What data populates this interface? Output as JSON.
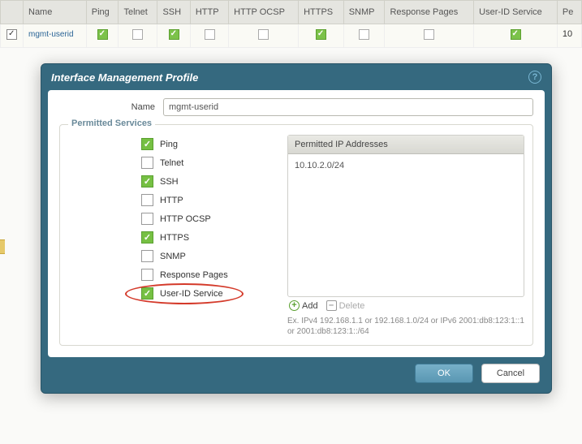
{
  "table": {
    "headers": [
      "",
      "Name",
      "Ping",
      "Telnet",
      "SSH",
      "HTTP",
      "HTTP OCSP",
      "HTTPS",
      "SNMP",
      "Response Pages",
      "User-ID Service",
      "Pe"
    ],
    "row": {
      "selected": true,
      "name": "mgmt-userid",
      "ping": true,
      "telnet": false,
      "ssh": true,
      "http": false,
      "http_ocsp": false,
      "https": true,
      "snmp": false,
      "response_pages": false,
      "userid_service": true,
      "trail": "10"
    }
  },
  "dialog": {
    "title": "Interface Management Profile",
    "name_label": "Name",
    "name_value": "mgmt-userid",
    "legend": "Permitted Services",
    "services": [
      {
        "key": "ping",
        "label": "Ping",
        "checked": true,
        "highlight": false
      },
      {
        "key": "telnet",
        "label": "Telnet",
        "checked": false,
        "highlight": false
      },
      {
        "key": "ssh",
        "label": "SSH",
        "checked": true,
        "highlight": false
      },
      {
        "key": "http",
        "label": "HTTP",
        "checked": false,
        "highlight": false
      },
      {
        "key": "http_ocsp",
        "label": "HTTP OCSP",
        "checked": false,
        "highlight": false
      },
      {
        "key": "https",
        "label": "HTTPS",
        "checked": true,
        "highlight": false
      },
      {
        "key": "snmp",
        "label": "SNMP",
        "checked": false,
        "highlight": false
      },
      {
        "key": "response_pages",
        "label": "Response Pages",
        "checked": false,
        "highlight": false
      },
      {
        "key": "userid_service",
        "label": "User-ID Service",
        "checked": true,
        "highlight": true
      }
    ],
    "ip_header": "Permitted IP Addresses",
    "ip_list": [
      "10.10.2.0/24"
    ],
    "add_label": "Add",
    "delete_label": "Delete",
    "hint": "Ex. IPv4 192.168.1.1 or 192.168.1.0/24 or IPv6 2001:db8:123:1::1 or 2001:db8:123:1::/64",
    "ok": "OK",
    "cancel": "Cancel"
  }
}
